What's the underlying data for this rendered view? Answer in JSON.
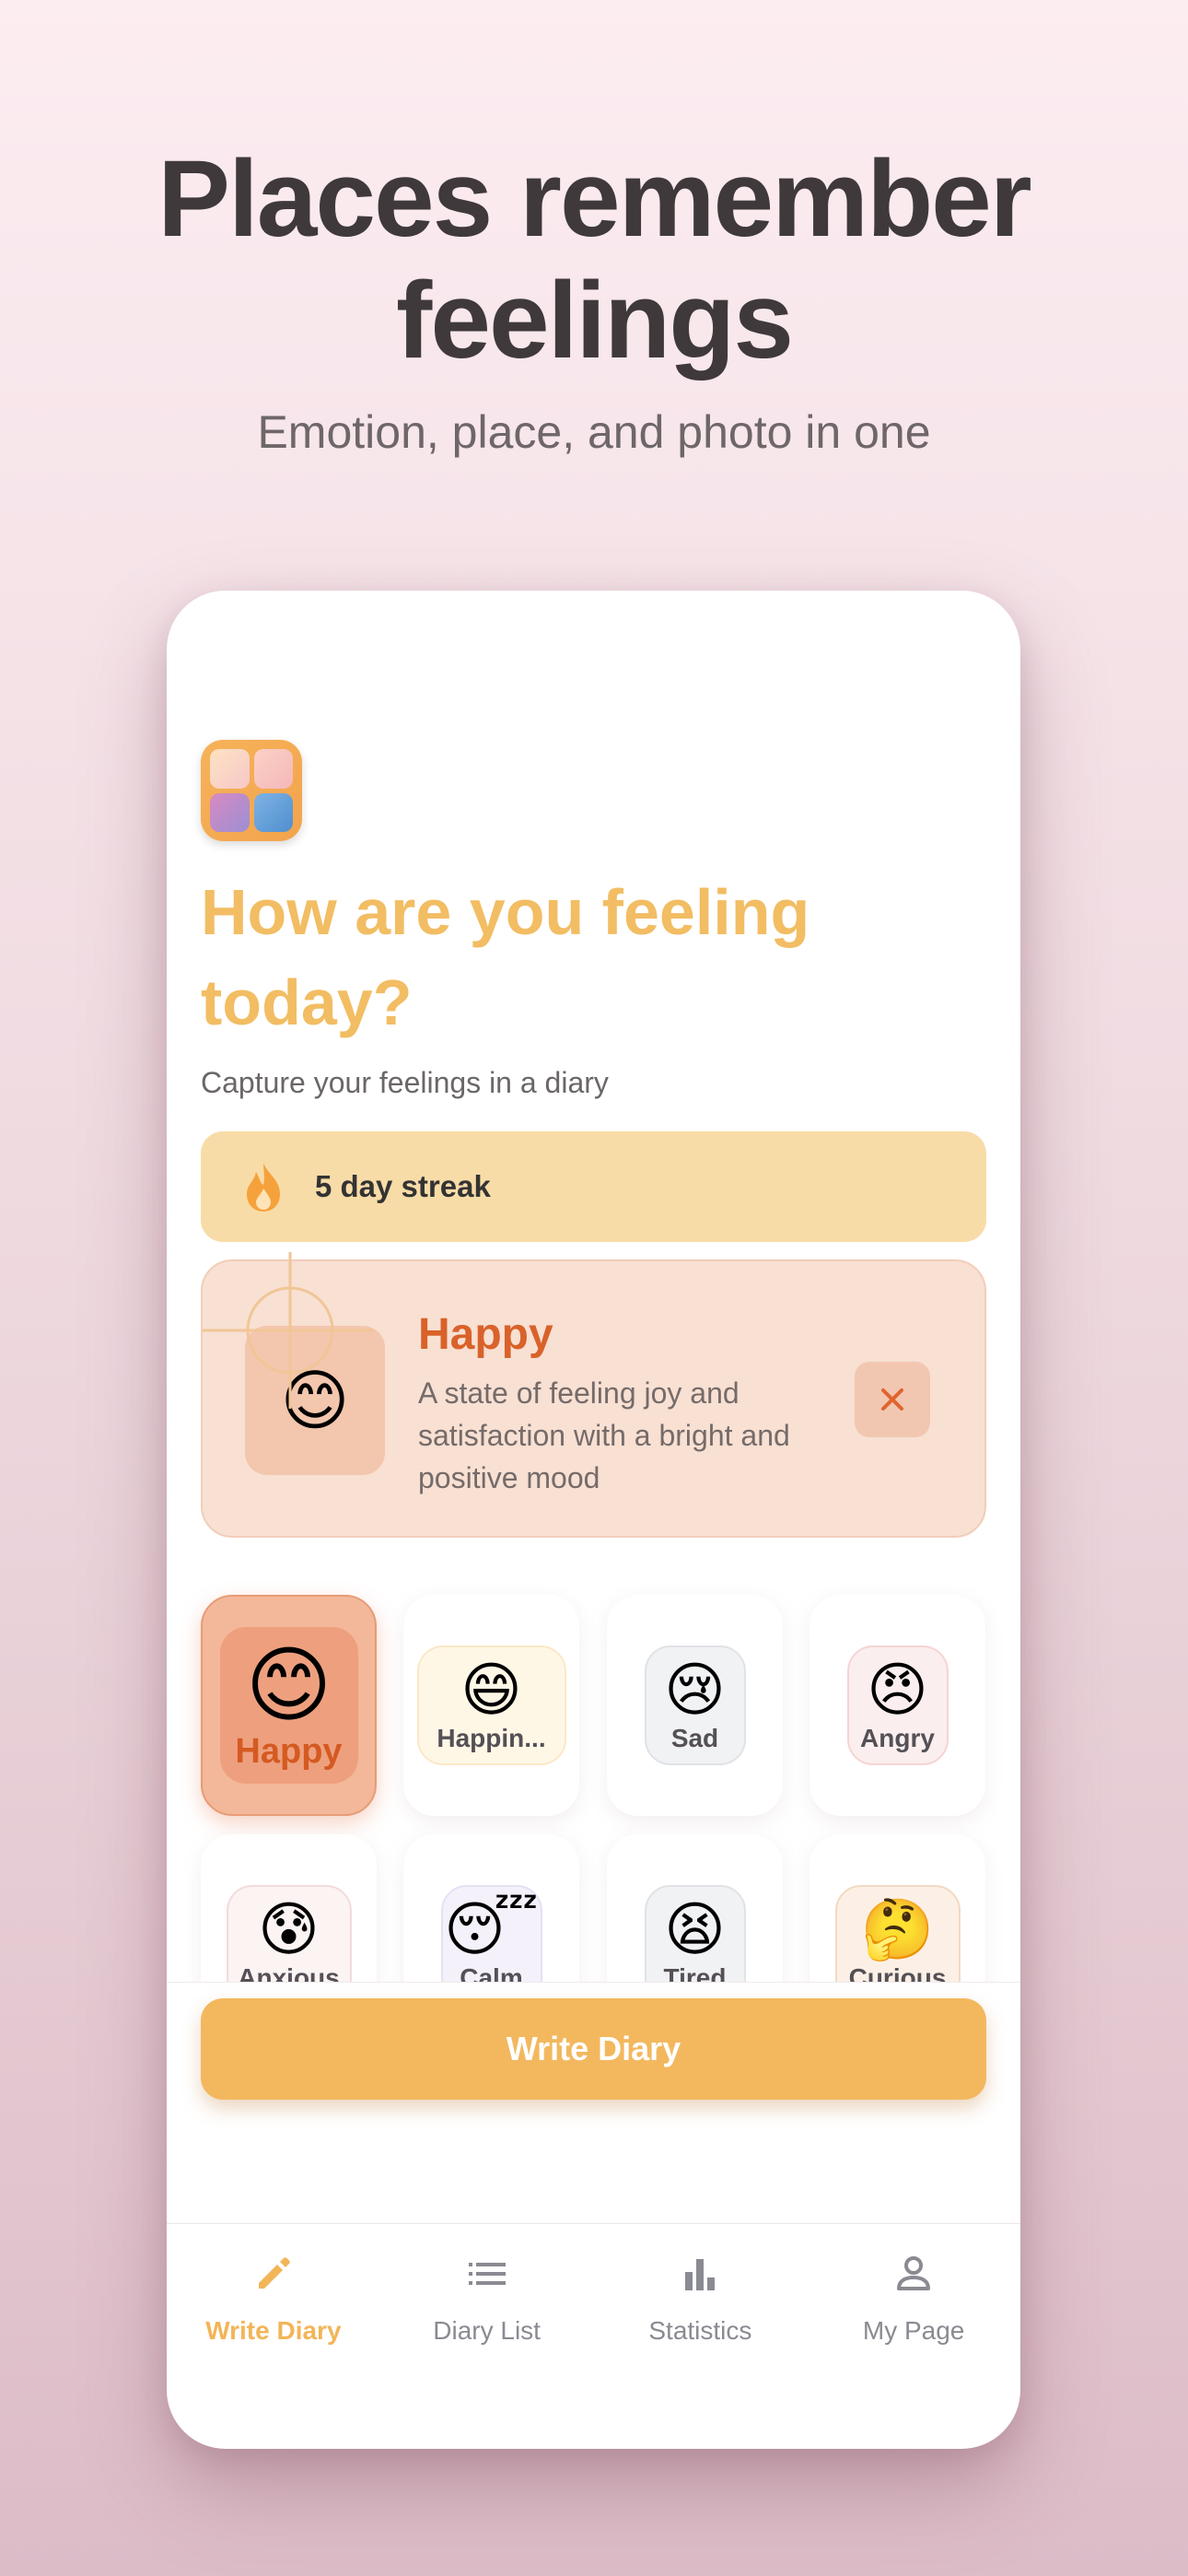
{
  "marketing": {
    "headline_line1": "Places remember",
    "headline_line2": "feelings",
    "subheadline": "Emotion, place, and photo in one"
  },
  "screen": {
    "title_line1": "How are you feeling",
    "title_line2": "today?",
    "caption": "Capture your feelings in a diary",
    "streak": {
      "icon": "flame-icon",
      "label": "5 day streak"
    },
    "selected_mood": {
      "emoji": "😊",
      "name": "Happy",
      "description": "A state of feeling joy and satisfaction with a bright and positive mood"
    },
    "moods": [
      {
        "emoji": "😊",
        "label": "Happy",
        "selected": true
      },
      {
        "emoji": "😄",
        "label": "Happin..."
      },
      {
        "emoji": "😢",
        "label": "Sad"
      },
      {
        "emoji": "😠",
        "label": "Angry"
      },
      {
        "emoji": "😰",
        "label": "Anxious"
      },
      {
        "emoji": "😴",
        "label": "Calm"
      },
      {
        "emoji": "😫",
        "label": "Tired"
      },
      {
        "emoji": "🤔",
        "label": "Curious"
      }
    ],
    "primary_button": "Write Diary"
  },
  "tabbar": [
    {
      "icon": "pencil-icon",
      "label": "Write Diary",
      "active": true
    },
    {
      "icon": "list-icon",
      "label": "Diary List"
    },
    {
      "icon": "bar-chart-icon",
      "label": "Statistics"
    },
    {
      "icon": "person-icon",
      "label": "My Page"
    }
  ],
  "colors": {
    "accent": "#f2b558",
    "title": "#f2bd63",
    "mood_highlight": "#d9622a",
    "streak_bg": "#f8dca7"
  }
}
